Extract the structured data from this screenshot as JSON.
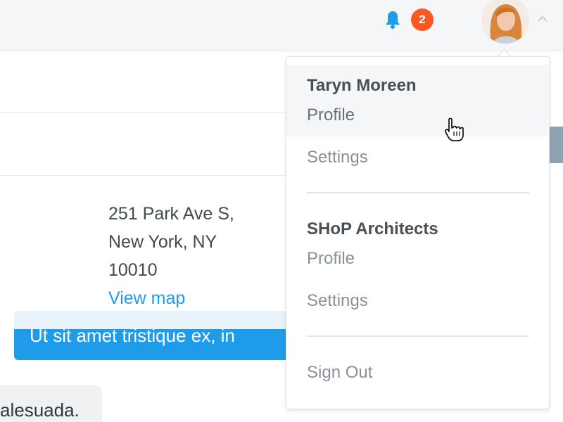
{
  "topbar": {
    "notification_count": "2",
    "colors": {
      "bell": "#1e9be9",
      "badge": "#ff5722"
    }
  },
  "content": {
    "address_lines": [
      "251 Park Ave S,",
      "New York, NY",
      "10010"
    ],
    "view_map": "View map",
    "message_text": "Ut sit amet tristique ex, in",
    "message2_text": "alesuada."
  },
  "account_menu": {
    "user": {
      "name": "Taryn Moreen",
      "profile": "Profile",
      "settings": "Settings"
    },
    "organization": {
      "name": "SHoP Architects",
      "profile": "Profile",
      "settings": "Settings"
    },
    "sign_out": "Sign Out"
  },
  "icons": {
    "bell": "bell-icon",
    "avatar": "avatar",
    "caret": "chevron-up-icon",
    "cursor": "hand-pointer-cursor"
  }
}
